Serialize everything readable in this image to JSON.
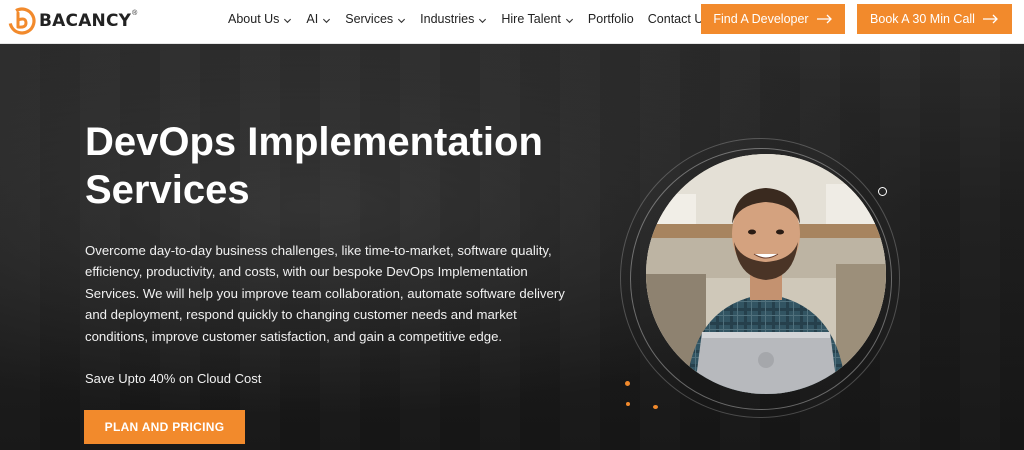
{
  "brand": {
    "name": "BACANCY",
    "registered": "®",
    "accent_color": "#f28a2c"
  },
  "nav": {
    "items": [
      {
        "label": "About Us",
        "has_dropdown": true
      },
      {
        "label": "AI",
        "has_dropdown": true
      },
      {
        "label": "Services",
        "has_dropdown": true
      },
      {
        "label": "Industries",
        "has_dropdown": true
      },
      {
        "label": "Hire Talent",
        "has_dropdown": true
      },
      {
        "label": "Portfolio",
        "has_dropdown": false
      },
      {
        "label": "Contact Us",
        "has_dropdown": false
      }
    ],
    "cta_find": "Find A Developer",
    "cta_book": "Book A 30 Min Call"
  },
  "hero": {
    "title_line1": "DevOps Implementation",
    "title_line2": "Services",
    "description": "Overcome day-to-day business challenges, like time-to-market, software quality, efficiency, productivity, and costs, with our bespoke DevOps Implementation Services. We will help you improve team collaboration, automate software delivery and deployment, respond quickly to changing customer needs and market conditions, improve customer satisfaction, and gain a competitive edge.",
    "savings": "Save Upto 40% on Cloud Cost",
    "cta_plan": "PLAN AND PRICING"
  }
}
